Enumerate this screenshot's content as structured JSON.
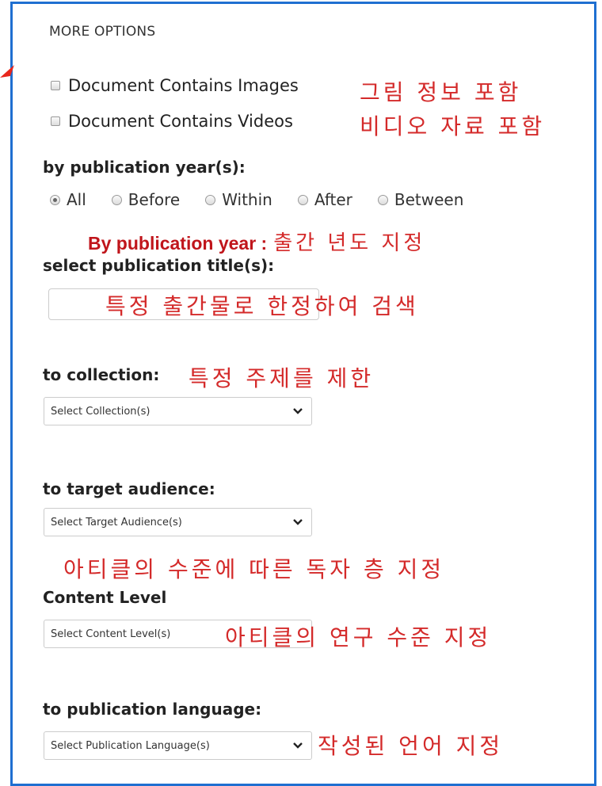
{
  "section_title": "MORE OPTIONS",
  "checkboxes": [
    {
      "label": "Document Contains Images",
      "annotation": "그림 정보 포함"
    },
    {
      "label": "Document Contains Videos",
      "annotation": "비디오 자료 포함"
    }
  ],
  "pub_year": {
    "heading": "by publication year(s):",
    "options": [
      "All",
      "Before",
      "Within",
      "After",
      "Between"
    ],
    "selected": "All",
    "annotation_en": "By publication year :",
    "annotation_ko": "출간 년도 지정"
  },
  "pub_title": {
    "heading": "select publication title(s):",
    "annotation": "특정 출간물로 한정하여 검색"
  },
  "collection": {
    "heading": "to collection:",
    "annotation": "특정 주제를 제한",
    "select_value": "Select Collection(s)"
  },
  "target_audience": {
    "heading": "to target audience:",
    "select_value": "Select Target Audience(s)",
    "annotation": "아티클의 수준에 따른 독자 층 지정"
  },
  "content_level": {
    "heading": "Content Level",
    "select_value": "Select Content Level(s)",
    "annotation": "아티클의 연구 수준 지정"
  },
  "pub_language": {
    "heading": "to publication language:",
    "select_value": "Select Publication Language(s)",
    "annotation": "작성된 언어 지정"
  },
  "colors": {
    "annotation_red": "#d42a2a",
    "frame_blue": "#1f6fd1"
  }
}
